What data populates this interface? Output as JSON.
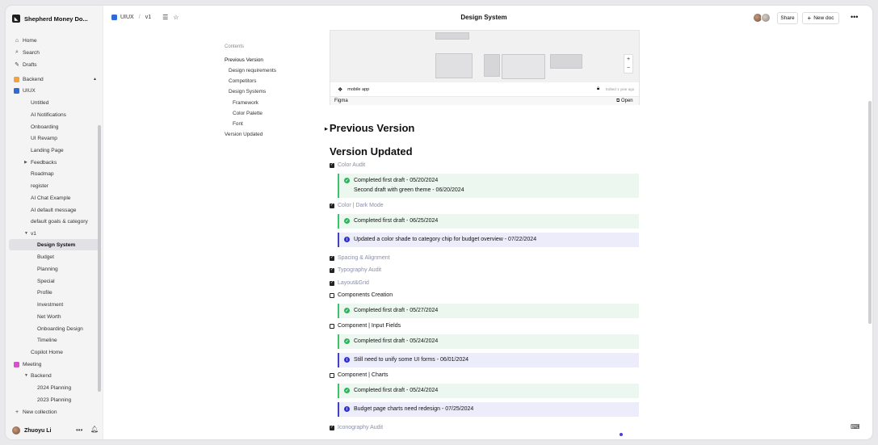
{
  "workspace": {
    "name": "Shepherd Money Do..."
  },
  "sidebar": {
    "nav": [
      {
        "label": "Home",
        "icon": "home-icon"
      },
      {
        "label": "Search",
        "icon": "search-icon"
      },
      {
        "label": "Drafts",
        "icon": "drafts-icon"
      }
    ],
    "collections": {
      "backend": "Backend",
      "uiux": "UIUX",
      "uiux_items": [
        "Untitled",
        "AI Notifications",
        "Onboarding",
        "UI Revamp",
        "Landing Page"
      ],
      "feedbacks": "Feedbacks",
      "uiux_items2": [
        "Roadmap",
        "register",
        "AI Chat Example",
        "AI default message",
        "default goals & category"
      ],
      "v1": "v1",
      "v1_items": [
        "Design System",
        "Budget",
        "Planning",
        "Special",
        "Profile",
        "Investment",
        "Net Worth",
        "Onboarding Design",
        "Timeline"
      ],
      "copilot": "Copilot Home",
      "meeting": "Meeting",
      "meeting_backend": "Backend",
      "meeting_items": [
        "2024 Planning",
        "2023 Planning"
      ],
      "new_collection": "New collection"
    },
    "user": {
      "name": "Zhuoyu Li"
    }
  },
  "topbar": {
    "crumb_collection": "UIUX",
    "crumb_doc": "v1",
    "title": "Design System",
    "share": "Share",
    "new_doc": "New doc"
  },
  "toc": {
    "heading": "Contents",
    "items": [
      "Previous Version",
      "Design requirements",
      "Competitors",
      "Design Systems",
      "Framework",
      "Color Palette",
      "Font",
      "Version Updated"
    ]
  },
  "figma": {
    "file_name": "mobile app",
    "edited": "Edited 1 year ago",
    "brand": "Figma",
    "open": "Open",
    "zoom_in": "+",
    "zoom_out": "−"
  },
  "content": {
    "previous_version": "Previous Version",
    "version_updated": "Version Updated",
    "tasks": [
      {
        "label": "Color Audit",
        "done": true
      },
      {
        "label": "Color | Dark Mode",
        "done": true
      },
      {
        "label": "Spacing & Alignment",
        "done": true
      },
      {
        "label": "Typography Audit",
        "done": true
      },
      {
        "label": "Layout&Grid",
        "done": true
      },
      {
        "label": "Components Creation",
        "done": false
      },
      {
        "label": "Component | Input Fields",
        "done": false
      },
      {
        "label": "Component | Charts",
        "done": false
      },
      {
        "label": "Iconography Audit",
        "done": true
      }
    ],
    "notes": {
      "n1a": "Completed first draft - 05/20/2024",
      "n1b": "Second draft with green theme - 06/20/2024",
      "n2": "Completed first draft - 06/25/2024",
      "n3": "Updated a color shade to category chip for budget overview - 07/22/2024",
      "n4": "Completed first draft - 05/27/2024",
      "n5": "Completed first draft - 05/24/2024",
      "n6": "Still need to unify some UI forms - 06/01/2024",
      "n7": "Completed first draft - 05/24/2024",
      "n8": "Budget page charts need redesign - 07/25/2024"
    }
  },
  "colors": {
    "success": "#2bb45c",
    "info": "#3032c8",
    "done_text": "#8b8fa8"
  }
}
